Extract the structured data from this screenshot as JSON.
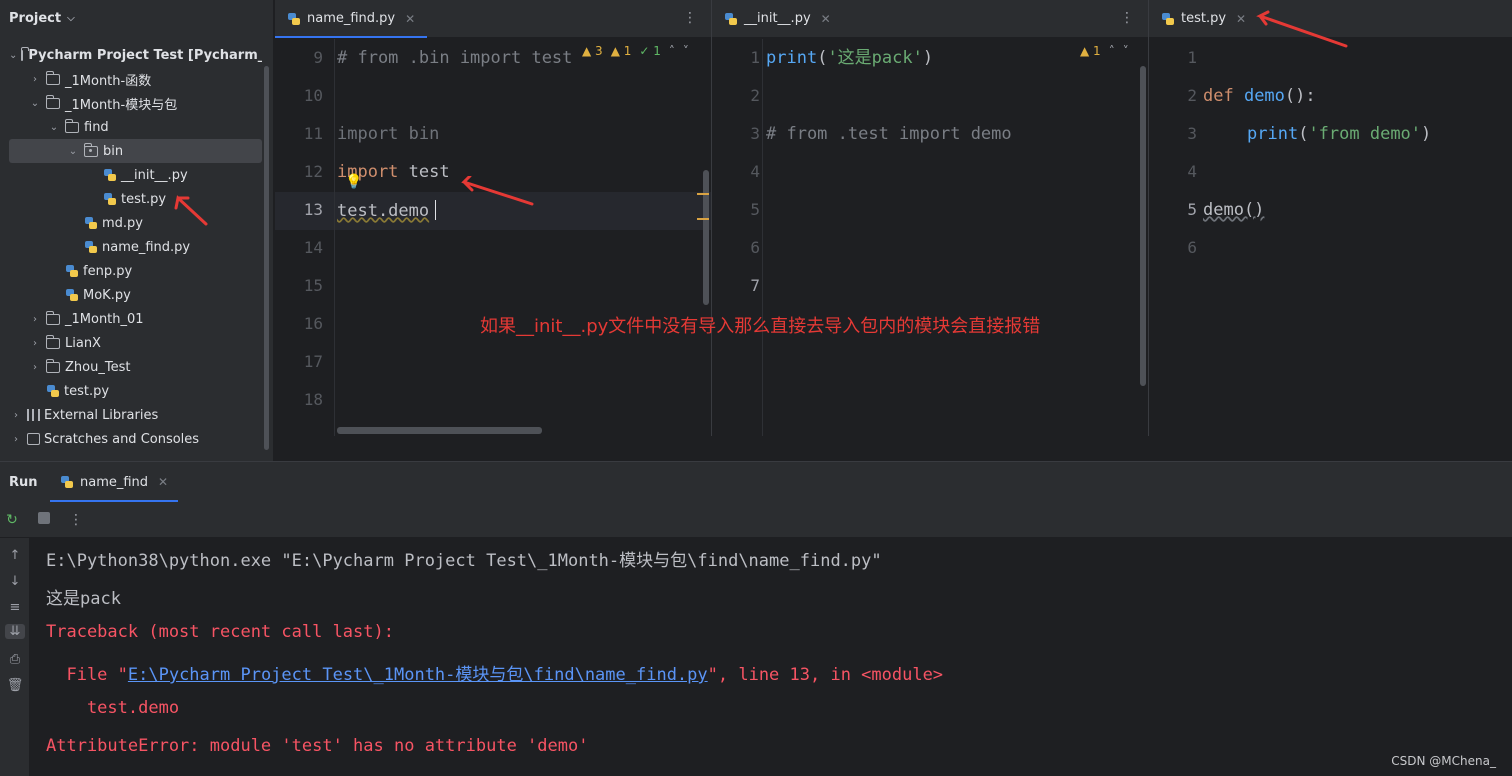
{
  "project": {
    "title": "Project",
    "tree": [
      {
        "label": "Pycharm Project Test [Pycharm_Proj",
        "type": "folder",
        "level": 0,
        "expanded": true
      },
      {
        "label": "_1Month-函数",
        "type": "folder",
        "level": 1,
        "expanded": false
      },
      {
        "label": "_1Month-模块与包",
        "type": "folder",
        "level": 1,
        "expanded": true
      },
      {
        "label": "find",
        "type": "folder",
        "level": 2,
        "expanded": true
      },
      {
        "label": "bin",
        "type": "package",
        "level": 3,
        "expanded": true,
        "selected": true
      },
      {
        "label": "__init__.py",
        "type": "py",
        "level": 4
      },
      {
        "label": "test.py",
        "type": "py",
        "level": 4
      },
      {
        "label": "md.py",
        "type": "py",
        "level": 3
      },
      {
        "label": "name_find.py",
        "type": "py",
        "level": 3
      },
      {
        "label": "fenp.py",
        "type": "py",
        "level": 2
      },
      {
        "label": "MoK.py",
        "type": "py",
        "level": 2
      },
      {
        "label": "_1Month_01",
        "type": "folder",
        "level": 1,
        "expanded": false
      },
      {
        "label": "LianX",
        "type": "folder",
        "level": 1,
        "expanded": false
      },
      {
        "label": "Zhou_Test",
        "type": "folder",
        "level": 1,
        "expanded": false
      },
      {
        "label": "test.py",
        "type": "py",
        "level": 1
      },
      {
        "label": "External Libraries",
        "type": "lib",
        "level": 0,
        "expanded": false
      },
      {
        "label": "Scratches and Consoles",
        "type": "scratch",
        "level": 0,
        "expanded": false
      }
    ]
  },
  "editors": {
    "name_find": {
      "tab": "name_find.py",
      "inspection": {
        "warnings": "3",
        "weak": "1",
        "ok": "1"
      },
      "line_numbers": [
        "9",
        "10",
        "11",
        "12",
        "13",
        "14",
        "15",
        "16",
        "17",
        "18"
      ],
      "lines": {
        "l9": "# from .bin import test",
        "l11_kw": "import",
        "l11_rest": " bin",
        "l12_kw": "import",
        "l12_rest": " test",
        "l13": "test.demo"
      }
    },
    "init": {
      "tab": "__init__.py",
      "inspection": {
        "warnings": "1"
      },
      "line_numbers": [
        "1",
        "2",
        "3",
        "4",
        "5",
        "6",
        "7"
      ],
      "lines": {
        "l1_fn": "print",
        "l1_open": "(",
        "l1_str": "'这是pack'",
        "l1_close": ")",
        "l3": "# from .test import demo"
      }
    },
    "test": {
      "tab": "test.py",
      "line_numbers": [
        "1",
        "2",
        "3",
        "4",
        "5",
        "6"
      ],
      "lines": {
        "l2_kw": "def",
        "l2_fn": " demo",
        "l2_rest": "():",
        "l3_fn": "print",
        "l3_open": "(",
        "l3_str": "'from demo'",
        "l3_close": ")",
        "l5": "demo()"
      }
    }
  },
  "annotation": "如果__init__.py文件中没有导入那么直接去导入包内的模块会直接报错",
  "run": {
    "title": "Run",
    "tab": "name_find",
    "output": {
      "cmd": "E:\\Python38\\python.exe \"E:\\Pycharm Project Test\\_1Month-模块与包\\find\\name_find.py\"",
      "pack": "这是pack",
      "traceback": "Traceback (most recent call last):",
      "file_prefix": "  File \"",
      "file_link": "E:\\Pycharm Project Test\\_1Month-模块与包\\find\\name_find.py",
      "file_suffix": "\", line 13, in <module>",
      "code": "    test.demo",
      "error": "AttributeError: module 'test' has no attribute 'demo'"
    }
  },
  "watermark": "CSDN @MChena_",
  "colors": {
    "accent": "#3574f0",
    "error": "#f75464",
    "annotation": "#e53935"
  }
}
